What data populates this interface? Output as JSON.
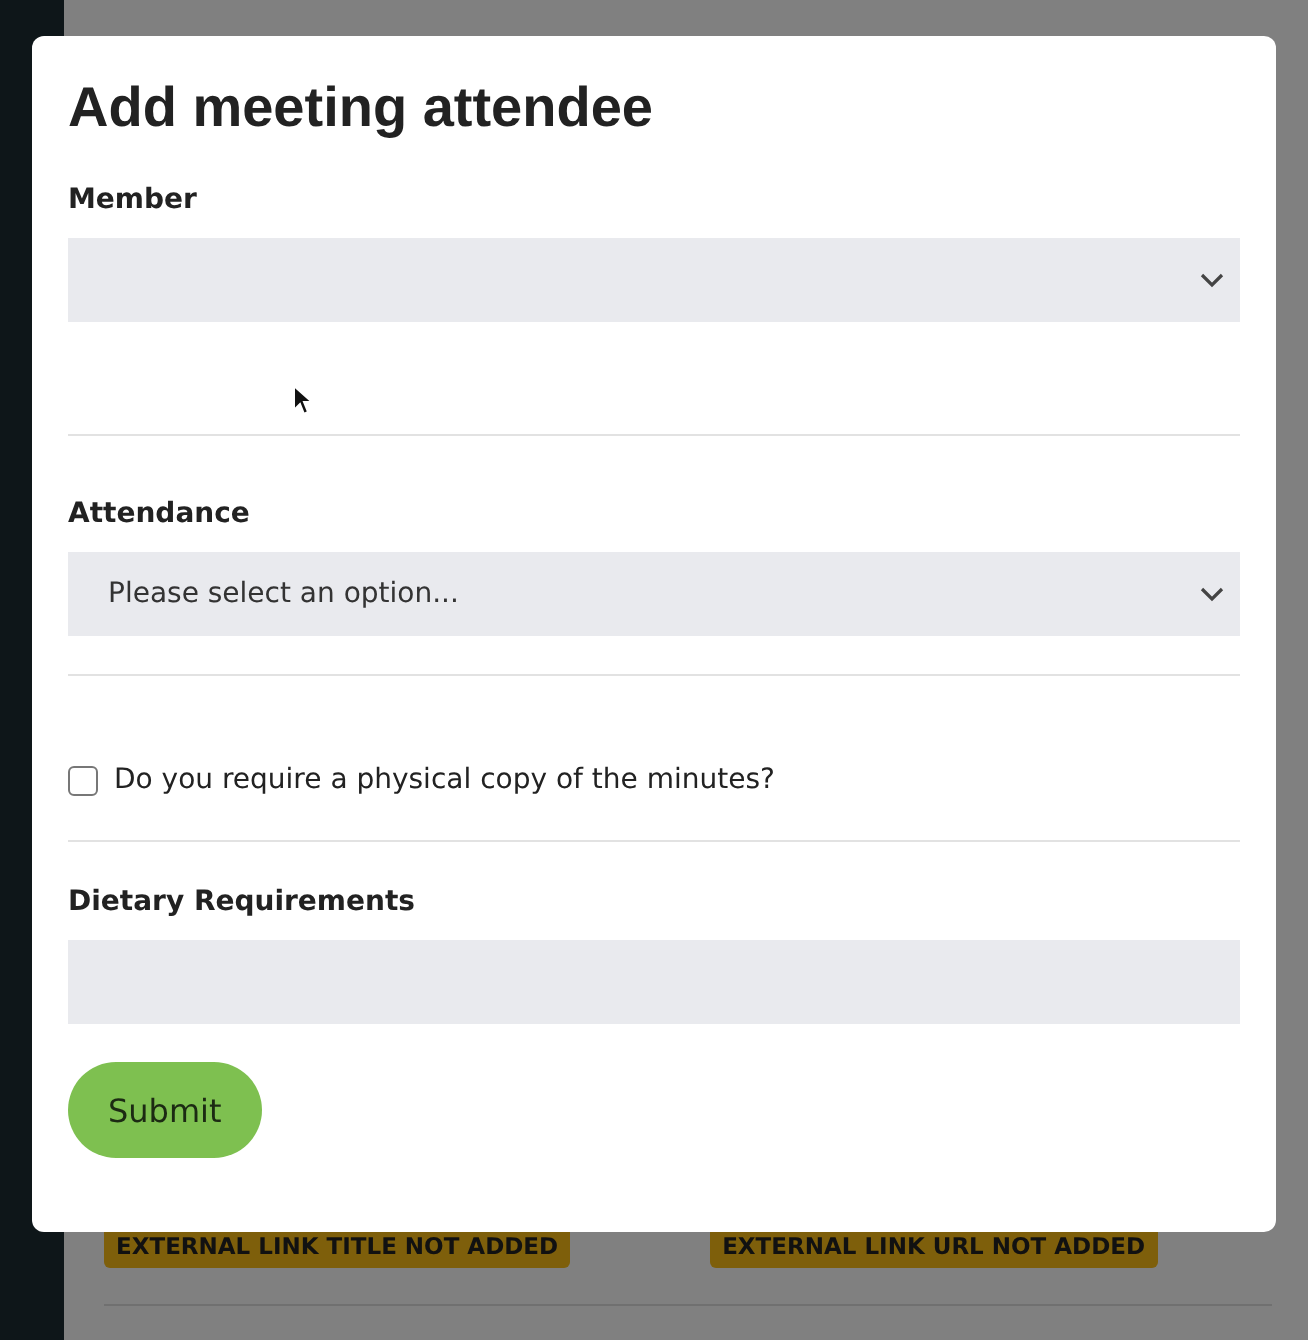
{
  "background": {
    "badges": [
      "EXTERNAL LINK TITLE NOT ADDED",
      "EXTERNAL LINK URL NOT ADDED"
    ]
  },
  "dialog": {
    "title": "Add meeting attendee",
    "fields": [
      {
        "kind": "select",
        "label": "Member"
      },
      {
        "kind": "select",
        "label": "Attendance",
        "value": "Please select an option..."
      },
      {
        "kind": "checkbox",
        "label": "Do you require a physical copy of the minutes?",
        "checked": false
      },
      {
        "kind": "text",
        "label": "Dietary Requirements"
      }
    ],
    "submit": "Submit"
  }
}
